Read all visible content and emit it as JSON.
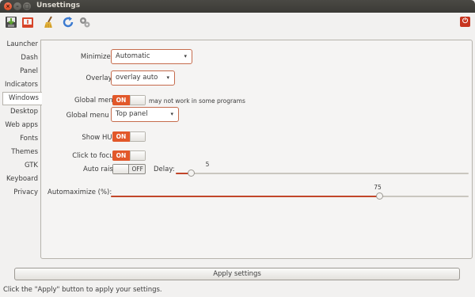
{
  "window": {
    "title": "Unsettings",
    "close_glyph": "×",
    "min_glyph": "–",
    "max_glyph": "□"
  },
  "toolbar": {
    "icons": [
      "save-icon",
      "open-icon",
      "broom-icon",
      "refresh-icon",
      "gears-icon"
    ],
    "power_glyph": "⏻"
  },
  "sidebar": {
    "items": [
      {
        "label": "Launcher"
      },
      {
        "label": "Dash"
      },
      {
        "label": "Panel"
      },
      {
        "label": "Indicators"
      },
      {
        "label": "Windows"
      },
      {
        "label": "Desktop"
      },
      {
        "label": "Web apps"
      },
      {
        "label": "Fonts"
      },
      {
        "label": "Themes"
      },
      {
        "label": "GTK"
      },
      {
        "label": "Keyboard"
      },
      {
        "label": "Privacy"
      }
    ],
    "active": "Windows"
  },
  "windows": {
    "minimize_animation": {
      "label": "Minimize animation:",
      "value": "Automatic",
      "arrow": "▾"
    },
    "overlay_scrollbars": {
      "label": "Overlay scrollbars:",
      "value": "overlay auto",
      "arrow": "▾"
    },
    "global_menu": {
      "label": "Global menu:",
      "state": "ON",
      "note": "may not work in some programs"
    },
    "global_menu_in": {
      "label": "Global menu in:",
      "value": "Top panel",
      "arrow": "▾"
    },
    "show_hud": {
      "label": "Show HUD:",
      "state": "ON"
    },
    "click_to_focus": {
      "label": "Click to focus:",
      "state": "ON"
    },
    "auto_raise": {
      "label": "Auto raise:",
      "state": "OFF"
    },
    "delay": {
      "label": "Delay:",
      "value": "5",
      "fraction": 0.05
    },
    "automaximize": {
      "label": "Automaximize  (%):",
      "value": "75",
      "fraction": 0.75
    }
  },
  "footer": {
    "apply_label": "Apply settings",
    "status": "Click the \"Apply\" button to apply your settings."
  },
  "colors": {
    "accent": "#e2582a",
    "titlebar": "#3c3b37"
  }
}
